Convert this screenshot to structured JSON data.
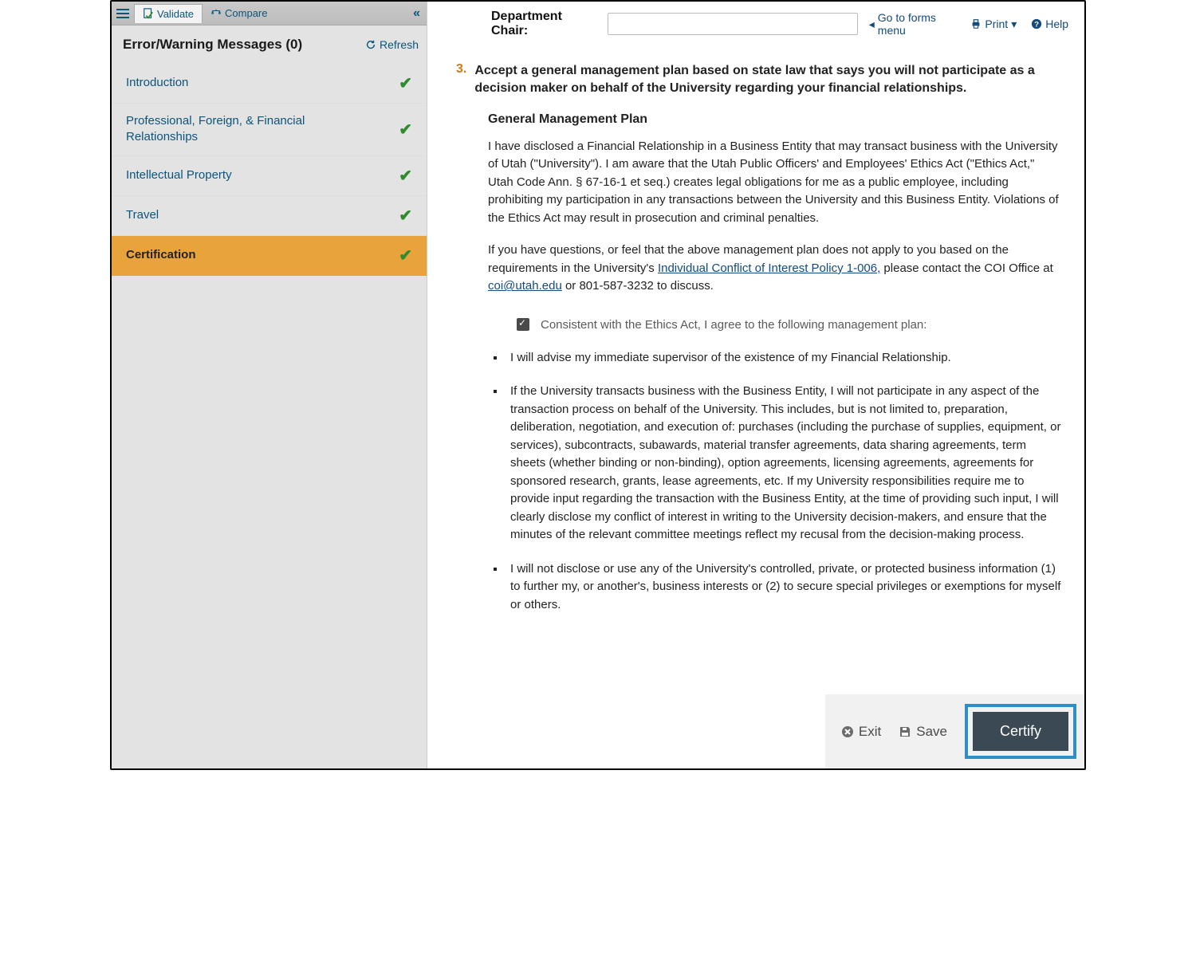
{
  "tabs": {
    "validate": "Validate",
    "compare": "Compare"
  },
  "sidebar": {
    "error_title": "Error/Warning Messages (0)",
    "refresh": "Refresh",
    "items": [
      {
        "label": "Introduction"
      },
      {
        "label": "Professional, Foreign, & Financial Relationships"
      },
      {
        "label": "Intellectual Property"
      },
      {
        "label": "Travel"
      },
      {
        "label": "Certification"
      }
    ]
  },
  "topbar": {
    "dept_label": "Department Chair:",
    "forms_menu": "Go to forms menu",
    "print": "Print",
    "help": "Help"
  },
  "content": {
    "q_num": "3.",
    "q_text": "Accept a general management plan based on state law that says you will not participate as a decision maker on behalf of the University regarding your financial relationships.",
    "sub_heading": "General Management Plan",
    "para1": "I have disclosed a Financial Relationship in a Business Entity that may transact business with the University of Utah (\"University\"). I am aware that the Utah Public Officers' and Employees' Ethics Act (\"Ethics Act,\" Utah Code Ann. § 67-16-1 et seq.) creates legal obligations for me as a public employee, including prohibiting my participation in any transactions between the University and this Business Entity. Violations of the Ethics Act may result in prosecution and criminal penalties.",
    "para2_a": "If you have questions, or feel that the above management plan does not apply to you based on the requirements in the University's ",
    "para2_link1": "Individual Conflict of Interest Policy 1-006,",
    "para2_b": " please contact the COI Office at ",
    "para2_link2": "coi@utah.edu",
    "para2_c": " or 801-587-3232 to discuss.",
    "agree_text": "Consistent with the Ethics Act, I agree to the following management plan:",
    "bullets": [
      "I will advise my immediate supervisor of the existence of my Financial Relationship.",
      "If the University transacts business with the Business Entity, I will not participate in any aspect of the transaction process on behalf of the University. This includes, but is not limited to, preparation, deliberation, negotiation, and execution of: purchases (including the purchase of supplies, equipment, or services), subcontracts, subawards, material transfer agreements, data sharing agreements, term sheets (whether binding or non-binding), option agreements, licensing agreements, agreements for sponsored research, grants, lease agreements, etc. If my University responsibilities require me to provide input regarding the transaction with the Business Entity, at the time of providing such input, I will clearly disclose my conflict of interest in writing to the University decision-makers, and ensure that the minutes of the relevant committee meetings reflect my recusal from the decision-making process.",
      "I will not disclose or use any of the University's controlled, private, or protected business information (1) to further my, or another's, business interests or (2) to secure special privileges or exemptions for myself or others."
    ]
  },
  "footer": {
    "exit": "Exit",
    "save": "Save",
    "certify": "Certify"
  }
}
